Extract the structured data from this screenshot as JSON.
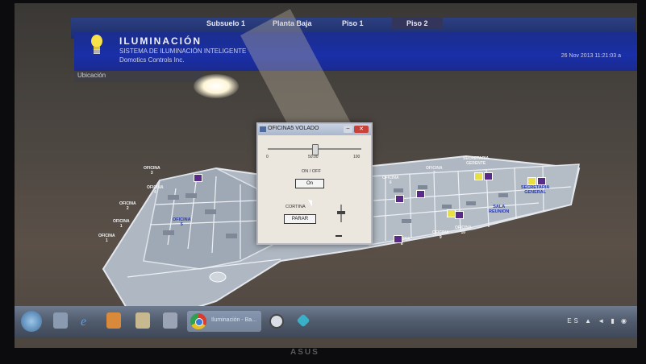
{
  "menu": {
    "items": [
      "Subsuelo 1",
      "Planta Baja",
      "Piso 1",
      "Piso 2"
    ],
    "active": "Piso 2"
  },
  "header": {
    "title": "ILUMINACIÓN",
    "subtitle": "SISTEMA DE ILUMINACIÓN INTELIGENTE",
    "company": "Domotics Controls Inc.",
    "datetime": "26 Nov 2013 11:21:03 a"
  },
  "location_label": "Ubicación",
  "rooms": [
    {
      "label": "OFICINA\n3"
    },
    {
      "label": "OFICINA\n4"
    },
    {
      "label": "OFICINA\n2"
    },
    {
      "label": "OFICINA\n1"
    },
    {
      "label": "OFICINA\n5"
    },
    {
      "label": "OFICINA\n6"
    },
    {
      "label": "OFICINA\n7"
    },
    {
      "label": "OFICINA\n8"
    },
    {
      "label": "OFICINA\n9"
    },
    {
      "label": "OFICINA\n10"
    },
    {
      "label": "SECRETARIA\nGERENTE"
    },
    {
      "label": "SECRETARIA\nGENERAL"
    },
    {
      "label": "SALA\nREUNION"
    }
  ],
  "dialog": {
    "title": "OFICINA5 VOLADO",
    "close_label": "✕",
    "min_label": "–",
    "slider": {
      "min_label": "0",
      "max_label": "100",
      "value_label": "50.00",
      "value": 50
    },
    "onoff_label": "ON / OFF",
    "on_button": "On",
    "cortina_label": "CORTINA",
    "parar_button": "PARAR"
  },
  "taskbar": {
    "app_label": "Iluminación - Ba...",
    "tray": "ES ▲ ◄ ▮ ◉"
  },
  "bezel_brand": "ASUS",
  "colors": {
    "banner": "#1a2fa8",
    "menubar": "#1e2e6a",
    "room_badge": "#5a2a88",
    "room_badge_on": "#e8e040",
    "room_blue_label": "#2a3aa8"
  }
}
